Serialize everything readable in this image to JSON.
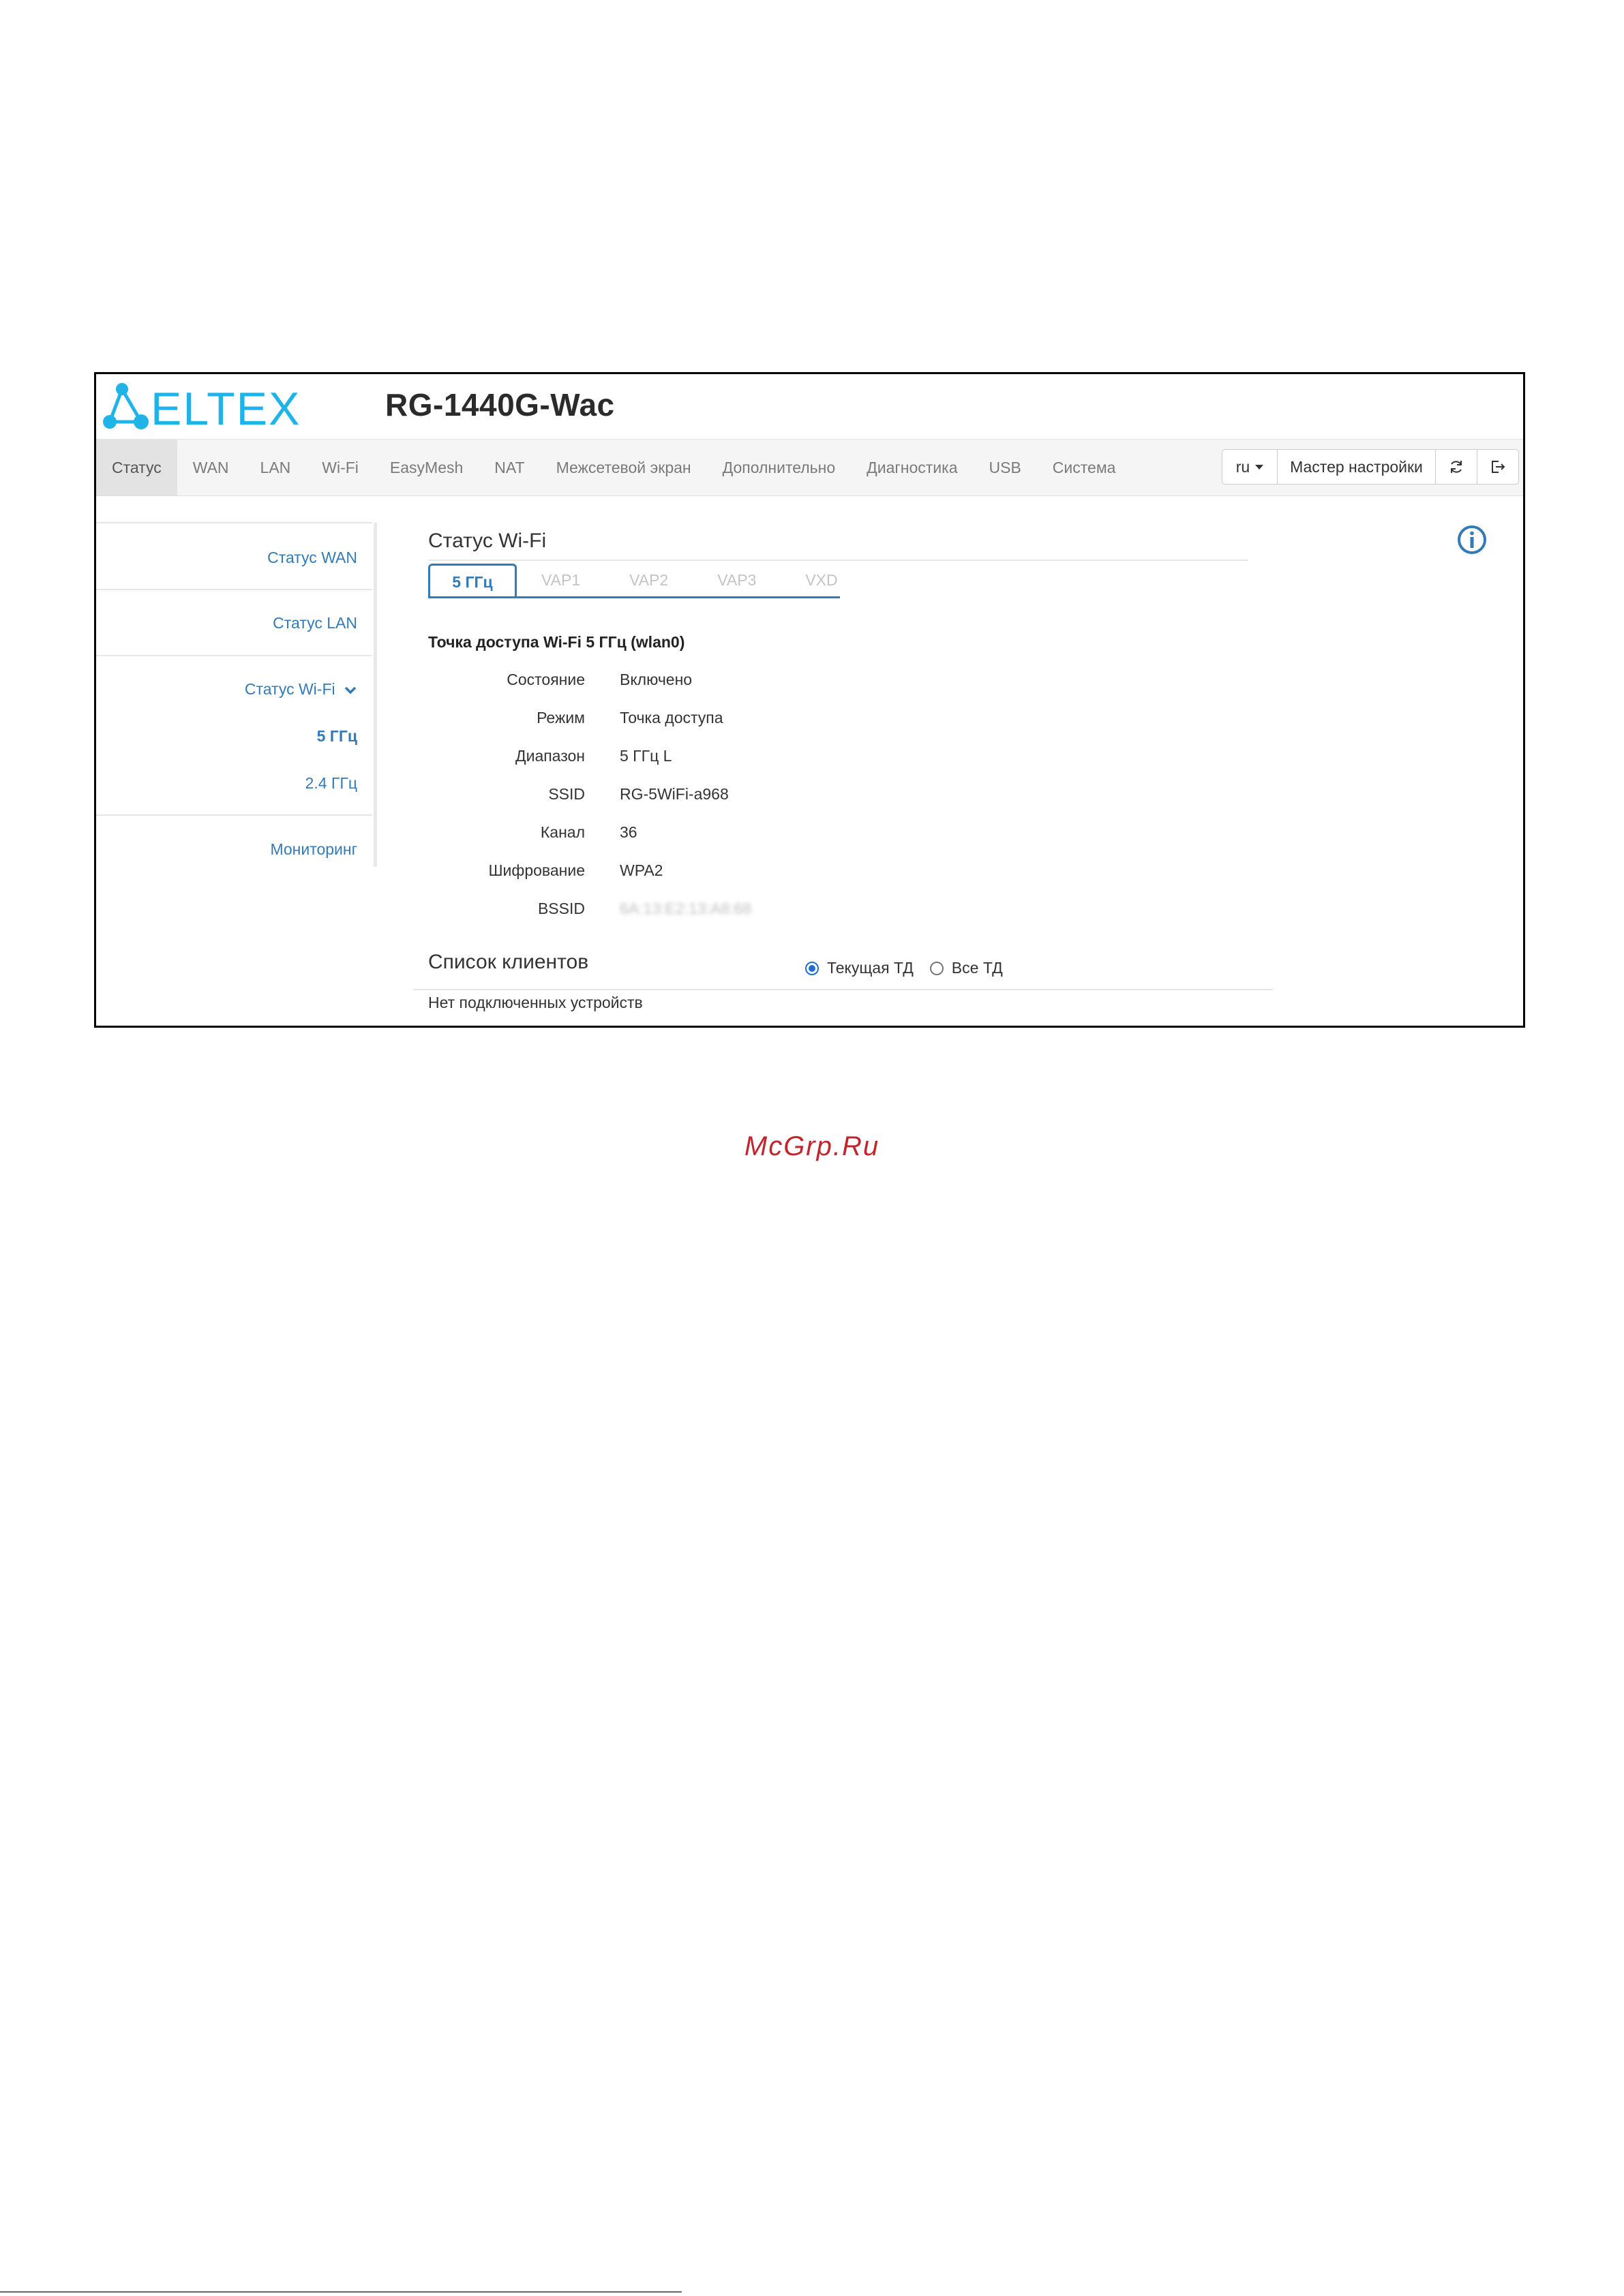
{
  "header": {
    "logo_text": "ELTEX",
    "device_model": "RG-1440G-Wac"
  },
  "navbar": {
    "items": [
      {
        "label": "Статус",
        "active": true
      },
      {
        "label": "WAN"
      },
      {
        "label": "LAN"
      },
      {
        "label": "Wi-Fi"
      },
      {
        "label": "EasyMesh"
      },
      {
        "label": "NAT"
      },
      {
        "label": "Межсетевой экран"
      },
      {
        "label": "Дополнительно"
      },
      {
        "label": "Диагностика"
      },
      {
        "label": "USB"
      },
      {
        "label": "Система"
      }
    ],
    "language": "ru",
    "wizard_label": "Мастер настройки",
    "refresh_icon": "refresh-icon",
    "logout_icon": "logout-icon"
  },
  "sidebar": {
    "items": [
      {
        "label": "Статус WAN"
      },
      {
        "label": "Статус LAN"
      },
      {
        "label": "Статус Wi-Fi",
        "expanded": true
      },
      {
        "label": "5 ГГц",
        "selected": true
      },
      {
        "label": "2.4 ГГц"
      },
      {
        "label": "Мониторинг"
      }
    ]
  },
  "wifi_status": {
    "title": "Статус Wi-Fi",
    "tabs": [
      {
        "label": "5 ГГц",
        "active": true
      },
      {
        "label": "VAP1"
      },
      {
        "label": "VAP2"
      },
      {
        "label": "VAP3"
      },
      {
        "label": "VXD"
      }
    ],
    "ap_heading": "Точка доступа Wi-Fi 5 ГГц (wlan0)",
    "rows": [
      {
        "label": "Состояние",
        "value": "Включено"
      },
      {
        "label": "Режим",
        "value": "Точка доступа"
      },
      {
        "label": "Диапазон",
        "value": "5 ГГц L"
      },
      {
        "label": "SSID",
        "value": "RG-5WiFi-a968"
      },
      {
        "label": "Канал",
        "value": "36"
      },
      {
        "label": "Шифрование",
        "value": "WPA2"
      },
      {
        "label": "BSSID",
        "value": "6A:13:E2:13:A8:68"
      }
    ],
    "info_icon": "info-icon"
  },
  "clients": {
    "title": "Список клиентов",
    "filter_options": [
      {
        "label": "Текущая ТД",
        "checked": true
      },
      {
        "label": "Все ТД",
        "checked": false
      }
    ],
    "empty_message": "Нет подключенных устройств"
  },
  "watermark": "McGrp.Ru",
  "colors": {
    "accent": "#337ab7",
    "logo": "#1fb4e8",
    "watermark": "#c0272d",
    "navbar_bg": "#f5f5f5"
  }
}
